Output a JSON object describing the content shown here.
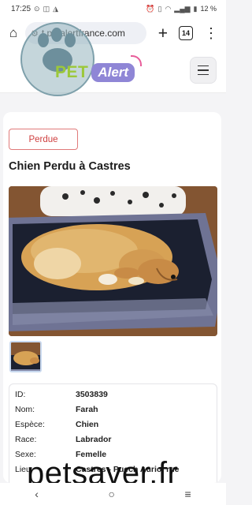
{
  "status_bar": {
    "time": "17:25",
    "notification_icons": [
      "messenger-icon",
      "message-icon",
      "navigation-icon"
    ],
    "battery": "12 %",
    "signal_icons": [
      "alarm-icon",
      "vibrate-icon",
      "wifi-icon",
      "signal-icon",
      "battery-icon"
    ]
  },
  "browser": {
    "url": "t.petalertfrance.com",
    "tab_count": "14"
  },
  "site": {
    "logo_pet": "PET",
    "logo_alert": "Alert"
  },
  "listing": {
    "badge": "Perdue",
    "title": "Chien Perdu à Castres",
    "details": [
      {
        "label": "ID:",
        "value": "3503839"
      },
      {
        "label": "Nom:",
        "value": "Farah"
      },
      {
        "label": "Espèce:",
        "value": "Chien"
      },
      {
        "label": "Race:",
        "value": "Labrador"
      },
      {
        "label": "Sexe:",
        "value": "Femelle"
      },
      {
        "label": "Lieu:",
        "value": "Castres - Puech Auriol rue"
      }
    ]
  },
  "watermark": "petsaver.fr",
  "nav": {
    "back": "‹",
    "home": "○",
    "recents": "≡"
  }
}
